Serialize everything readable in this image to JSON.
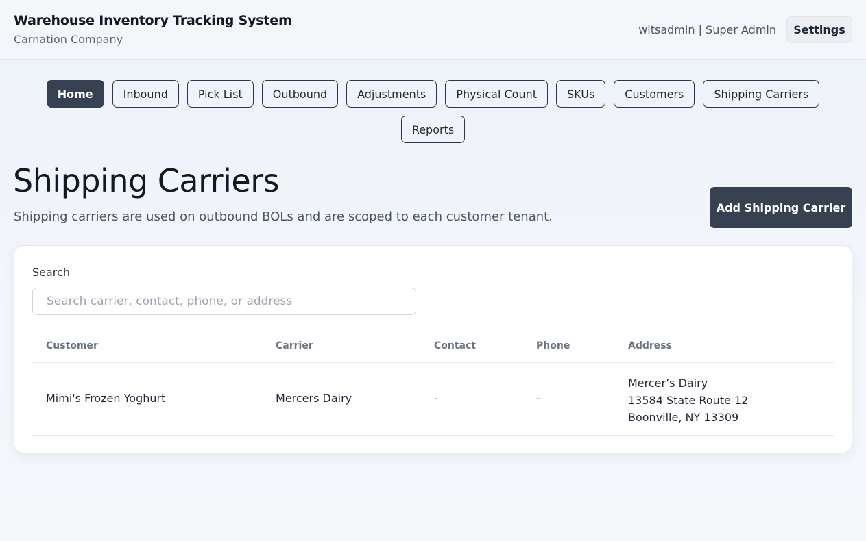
{
  "header": {
    "title": "Warehouse Inventory Tracking System",
    "subtitle": "Carnation Company",
    "user_info": "witsadmin | Super Admin",
    "settings_label": "Settings"
  },
  "nav": {
    "row1": [
      "Home",
      "Inbound",
      "Pick List",
      "Outbound",
      "Adjustments",
      "Physical Count",
      "SKUs",
      "Customers",
      "Shipping Carriers"
    ],
    "row2": [
      "Reports"
    ],
    "active": "Home"
  },
  "page": {
    "title": "Shipping Carriers",
    "description": "Shipping carriers are used on outbound BOLs and are scoped to each customer tenant.",
    "add_button": "Add Shipping Carrier"
  },
  "search": {
    "label": "Search",
    "placeholder": "Search carrier, contact, phone, or address",
    "value": ""
  },
  "table": {
    "columns": [
      "Customer",
      "Carrier",
      "Contact",
      "Phone",
      "Address"
    ],
    "rows": [
      {
        "customer": "Mimi's Frozen Yoghurt",
        "carrier": "Mercers Dairy",
        "contact": "-",
        "phone": "-",
        "address": [
          "Mercer’s Dairy",
          "13584 State Route 12",
          "Boonville, NY 13309"
        ]
      }
    ]
  },
  "colors": {
    "accent_dark": "#374151",
    "background": "#eef3fa"
  }
}
